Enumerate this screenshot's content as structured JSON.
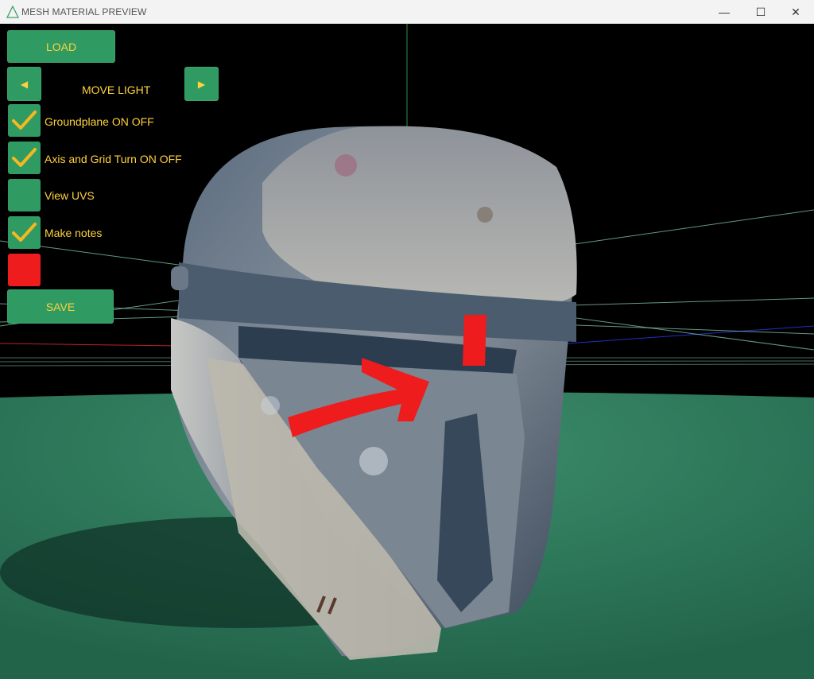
{
  "window": {
    "title": "MESH MATERIAL PREVIEW",
    "minimize_glyph": "—",
    "maximize_glyph": "☐",
    "close_glyph": "✕"
  },
  "panel": {
    "load_label": "LOAD",
    "prev_glyph": "◀",
    "next_glyph": "▶",
    "move_light_label": "MOVE LIGHT",
    "checkboxes": [
      {
        "label": "Groundplane ON OFF",
        "checked": true
      },
      {
        "label": "Axis and Grid Turn ON OFF",
        "checked": true
      },
      {
        "label": "View UVS",
        "checked": false
      },
      {
        "label": "Make notes",
        "checked": true
      }
    ],
    "note_color": "#ee1c1c",
    "save_label": "SAVE"
  },
  "colors": {
    "button_green": "#2f9b62",
    "label_yellow": "#ffd23c",
    "ground_green": "#2e7a5c",
    "annotation_red": "#ee1c1c"
  }
}
